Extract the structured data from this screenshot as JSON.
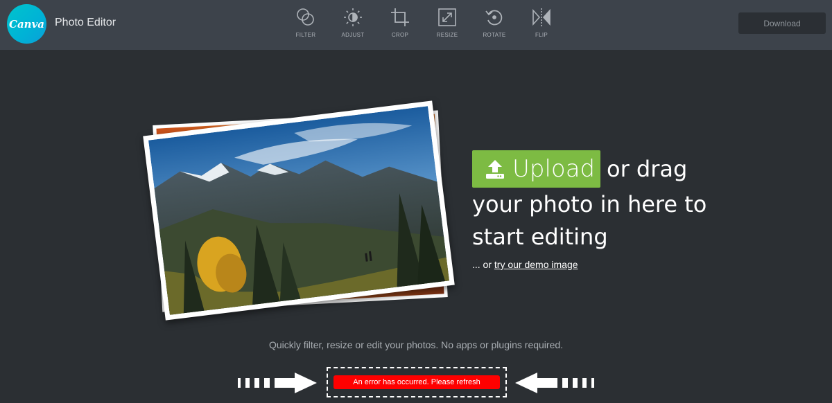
{
  "app": {
    "logo_text": "Canva",
    "title": "Photo Editor",
    "brand_color": "#00c4cc"
  },
  "toolbar": {
    "tools": [
      {
        "label": "FILTER",
        "icon": "filter-icon"
      },
      {
        "label": "ADJUST",
        "icon": "adjust-icon"
      },
      {
        "label": "CROP",
        "icon": "crop-icon"
      },
      {
        "label": "RESIZE",
        "icon": "resize-icon"
      },
      {
        "label": "ROTATE",
        "icon": "rotate-icon"
      },
      {
        "label": "FLIP",
        "icon": "flip-icon"
      }
    ],
    "download_label": "Download"
  },
  "upload": {
    "button_label": "Upload",
    "button_color": "#7dbb43",
    "line1": "or drag",
    "line2": "your photo in here to",
    "line3": "start editing",
    "demo_prefix": "... or",
    "demo_link": "try our demo image"
  },
  "tagline": "Quickly filter, resize or edit your photos. No apps or plugins required.",
  "error": {
    "message": "An error has occurred. Please refresh",
    "color": "#ff0000"
  }
}
